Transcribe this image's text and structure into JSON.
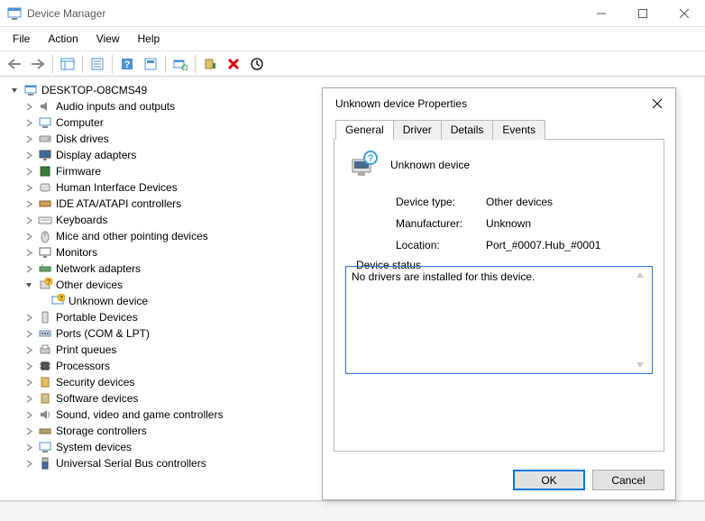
{
  "window": {
    "title": "Device Manager"
  },
  "menus": [
    "File",
    "Action",
    "View",
    "Help"
  ],
  "tree": {
    "root": "DESKTOP-O8CMS49",
    "categories": [
      "Audio inputs and outputs",
      "Computer",
      "Disk drives",
      "Display adapters",
      "Firmware",
      "Human Interface Devices",
      "IDE ATA/ATAPI controllers",
      "Keyboards",
      "Mice and other pointing devices",
      "Monitors",
      "Network adapters",
      "Other devices",
      "Portable Devices",
      "Ports (COM & LPT)",
      "Print queues",
      "Processors",
      "Security devices",
      "Software devices",
      "Sound, video and game controllers",
      "Storage controllers",
      "System devices",
      "Universal Serial Bus controllers"
    ],
    "other_child": "Unknown device"
  },
  "dialog": {
    "title": "Unknown device Properties",
    "tabs": [
      "General",
      "Driver",
      "Details",
      "Events"
    ],
    "device_name": "Unknown device",
    "labels": {
      "device_type": "Device type:",
      "manufacturer": "Manufacturer:",
      "location": "Location:",
      "status_heading": "Device status"
    },
    "values": {
      "device_type": "Other devices",
      "manufacturer": "Unknown",
      "location": "Port_#0007.Hub_#0001"
    },
    "status_text": "No drivers are installed for this device.",
    "buttons": {
      "ok": "OK",
      "cancel": "Cancel"
    }
  }
}
